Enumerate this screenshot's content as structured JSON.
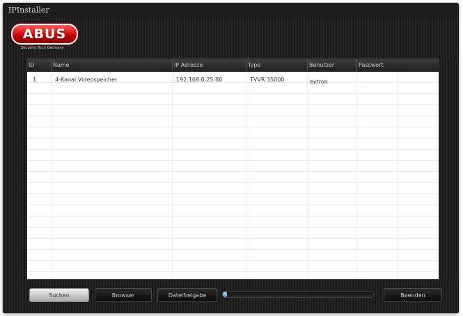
{
  "window": {
    "title": "IPInstaller"
  },
  "brand": {
    "logo_text": "ABUS",
    "tagline": "Security Tech Germany"
  },
  "table": {
    "columns": [
      "ID",
      "Name",
      "IP Adresse",
      "Type",
      "Benutzer",
      "Passwort"
    ],
    "rows": [
      {
        "id": "1",
        "name": "4-Kanal Videospeicher",
        "ip": "192.168.0.25:80",
        "type": "TVVR 35000",
        "user": "eytron",
        "password": ""
      }
    ]
  },
  "buttons": {
    "search": "Suchen",
    "browser": "Browser",
    "share": "Dateifreigabe",
    "exit": "Beenden"
  },
  "progress": {
    "value": 0.03
  },
  "colors": {
    "brand_red": "#c30000",
    "progress_blue": "#3aa0e6"
  }
}
